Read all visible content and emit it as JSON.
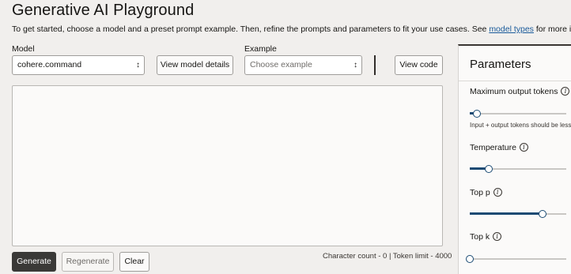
{
  "header": {
    "title": "Generative AI Playground",
    "intro_text": "To get started, choose a model and a preset prompt example. Then, refine the prompts and parameters to fit your use cases. See ",
    "intro_link": "model types",
    "intro_suffix": " for more informatio"
  },
  "model": {
    "label": "Model",
    "selected": "cohere.command",
    "details_button": "View model details"
  },
  "example": {
    "label": "Example",
    "placeholder": "Choose example"
  },
  "toolbar": {
    "view_code": "View code",
    "generate": "Generate",
    "regenerate": "Regenerate",
    "clear": "Clear"
  },
  "prompt": {
    "value": "",
    "char_count_text": "Character count - 0 | Token limit - 4000"
  },
  "parameters": {
    "title": "Parameters",
    "items": [
      {
        "label": "Maximum output tokens",
        "hint": "Input + output tokens should be less",
        "level": 0.07
      },
      {
        "label": "Temperature",
        "level": 0.2
      },
      {
        "label": "Top p",
        "level": 0.75
      },
      {
        "label": "Top k",
        "level": 0.0
      }
    ]
  },
  "colors": {
    "accent": "#1a4a73",
    "primary_button": "#3a3937",
    "link": "#1a5a9a",
    "background": "#f1efed"
  }
}
